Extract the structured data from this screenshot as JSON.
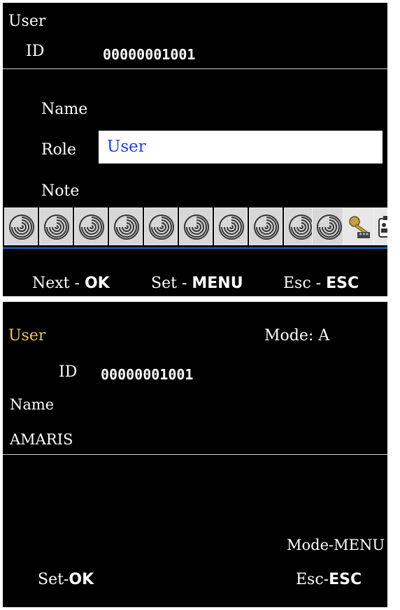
{
  "screen1": {
    "title": "User",
    "id_label": "ID",
    "id_value": "00000001001",
    "fields": {
      "name_label": "Name",
      "role_label": "Role",
      "role_value": "User",
      "note_label": "Note"
    },
    "icons": [
      "fingerprint-icon",
      "fingerprint-icon",
      "fingerprint-icon",
      "fingerprint-icon",
      "fingerprint-icon",
      "fingerprint-icon",
      "fingerprint-icon",
      "fingerprint-icon",
      "fingerprint-icon",
      "fingerprint-icon",
      "password-key-icon",
      "id-card-icon"
    ],
    "footer": {
      "next": "Next",
      "dash1": "-",
      "ok": "OK",
      "set": "Set",
      "dash2": "-",
      "menu": "MENU",
      "esc": "Esc",
      "dash3": "-",
      "esc_key": "ESC"
    },
    "colors": {
      "background": "#000000",
      "role_text": "#1a3cff",
      "separator": "#2266dd"
    }
  },
  "screen2": {
    "title": "User",
    "mode_label": "Mode: A",
    "id_label": "ID",
    "id_value": "00000001001",
    "name_label": "Name",
    "name_value": "AMARIS",
    "mode_menu": "Mode-MENU",
    "set_label": "Set-",
    "set_key": "OK",
    "esc_label": "Esc-",
    "esc_key": "ESC",
    "colors": {
      "title": "#f1c84a"
    }
  }
}
